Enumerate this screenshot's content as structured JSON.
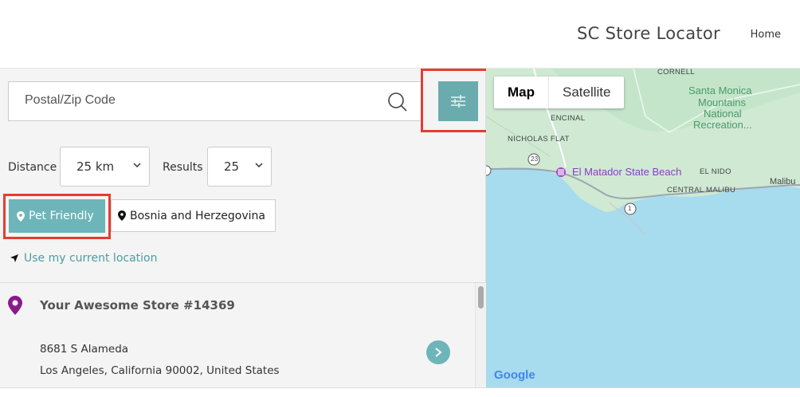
{
  "header": {
    "title": "SC Store Locator",
    "nav_home": "Home"
  },
  "search": {
    "placeholder": "Postal/Zip Code"
  },
  "filters": {
    "distance_label": "Distance",
    "distance_value": "25 km",
    "results_label": "Results",
    "results_value": "25",
    "pet_friendly": "Pet Friendly",
    "country": "Bosnia and Herzegovina",
    "use_location": "Use my current location"
  },
  "stores": [
    {
      "name": "Your Awesome Store #14369",
      "address_line1": "8681 S Alameda",
      "address_line2": "Los Angeles, California 90002, United States"
    }
  ],
  "map": {
    "tab_map": "Map",
    "tab_satellite": "Satellite",
    "labels": {
      "cornell": "CORNELL",
      "santa_monica": "Santa Monica",
      "mountains": "Mountains",
      "national": "National",
      "recreation": "Recreation...",
      "encinal": "ENCINAL",
      "nicholas_flat": "NICHOLAS FLAT",
      "el_matador": "El Matador State Beach",
      "el_nido": "EL NIDO",
      "central_malibu": "CENTRAL MALIBU",
      "malibu": "Malibu",
      "route_23": "23",
      "route_1": "1",
      "google": "Google"
    }
  },
  "colors": {
    "accent": "#6db5b8",
    "highlight": "#e53d30",
    "pin": "#8a1a8a",
    "link": "#4a9ea3"
  }
}
